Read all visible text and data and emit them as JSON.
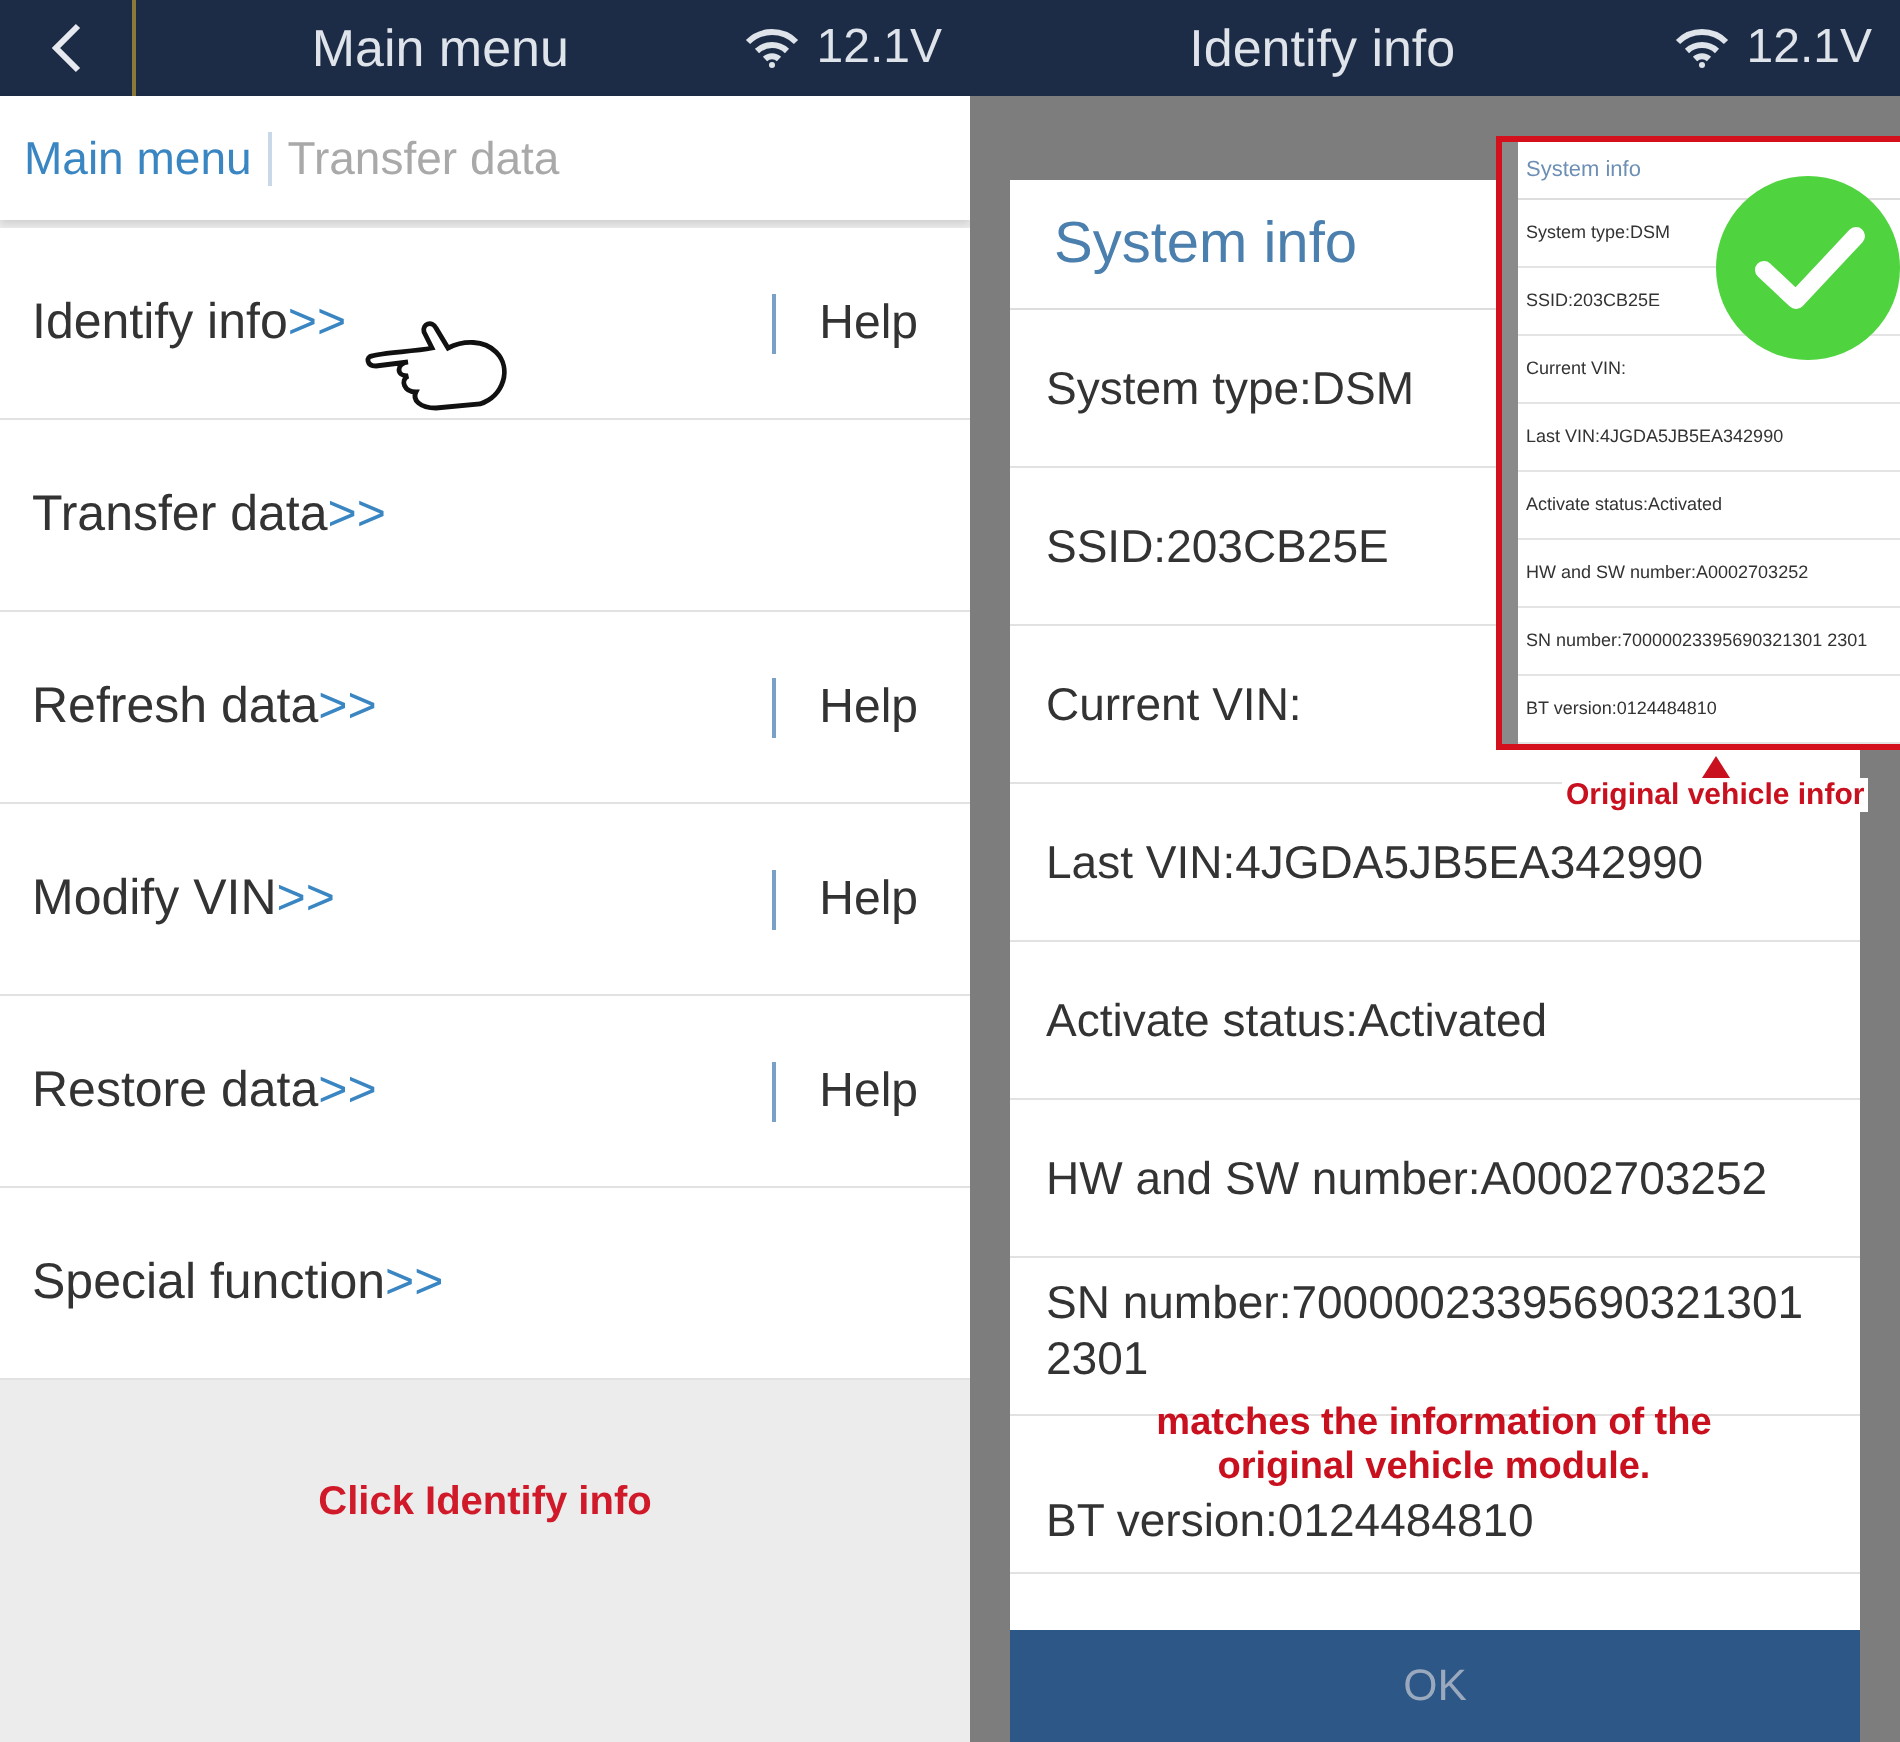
{
  "left_screen": {
    "header": {
      "title": "Main menu",
      "voltage": "12.1V"
    },
    "breadcrumb": [
      {
        "label": "Main menu",
        "selected": true
      },
      {
        "label": "Transfer data",
        "selected": false
      }
    ],
    "menu_items": [
      {
        "label": "Identify info",
        "arrow": ">>",
        "help": "Help",
        "pointed": true
      },
      {
        "label": "Transfer data",
        "arrow": ">>",
        "pointed": false
      },
      {
        "label": "Refresh data",
        "arrow": ">>",
        "help": "Help",
        "pointed": false
      },
      {
        "label": "Modify VIN",
        "arrow": ">>",
        "help": "Help",
        "pointed": false
      },
      {
        "label": "Restore data",
        "arrow": ">>",
        "help": "Help",
        "pointed": false
      },
      {
        "label": "Special function",
        "arrow": ">>",
        "pointed": false
      }
    ],
    "annotation": "Click Identify info"
  },
  "right_screen": {
    "header": {
      "title": "Identify info",
      "voltage": "12.1V"
    },
    "dialog": {
      "title": "System info",
      "rows": [
        "System type:DSM",
        "SSID:203CB25E",
        "Current VIN:",
        "Last VIN:4JGDA5JB5EA342990",
        "Activate status:Activated",
        "HW and SW number:A0002703252",
        "SN number:70000023395690321301 2301",
        "BT version:0124484810"
      ],
      "button": "OK"
    },
    "inset": {
      "title": "System info",
      "rows": [
        "System type:DSM",
        "SSID:203CB25E",
        "Current VIN:",
        "Last VIN:4JGDA5JB5EA342990",
        "Activate status:Activated",
        "HW and SW number:A0002703252",
        "SN number:70000023395690321301 2301",
        "BT version:0124484810"
      ],
      "verified": true,
      "caption": "Original vehicle infor"
    },
    "annotation": "matches the information of the original vehicle module."
  }
}
